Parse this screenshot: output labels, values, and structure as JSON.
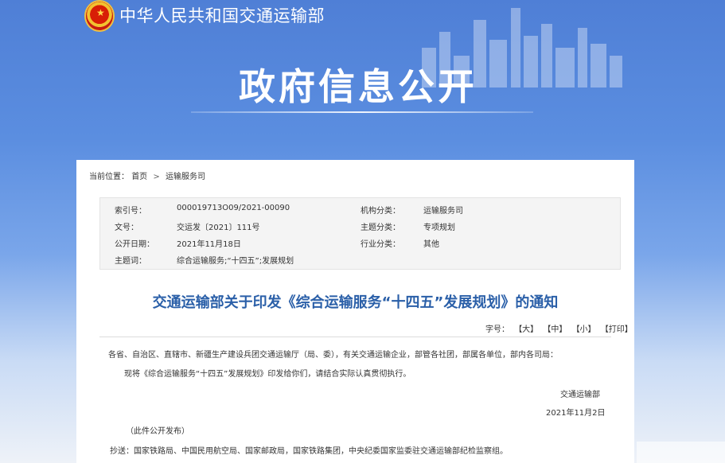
{
  "header": {
    "ministry_name": "中华人民共和国交通运输部",
    "banner_title": "政府信息公开"
  },
  "breadcrumb": {
    "prefix": "当前位置：",
    "items": [
      "首页",
      "运输服务司"
    ],
    "separator": ">"
  },
  "meta": {
    "index_label": "索引号：",
    "index_value": "000019713O09/2021-00090",
    "org_label": "机构分类：",
    "org_value": "运输服务司",
    "doc_no_label": "文号：",
    "doc_no_value": "交运发〔2021〕111号",
    "topic_label": "主题分类：",
    "topic_value": "专项规划",
    "date_label": "公开日期：",
    "date_value": "2021年11月18日",
    "industry_label": "行业分类：",
    "industry_value": "其他",
    "keywords_label": "主题词：",
    "keywords_value": "综合运输服务;“十四五”;发展规划"
  },
  "document": {
    "title": "交通运输部关于印发《综合运输服务“十四五”发展规划》的通知",
    "fontsize_label": "字号：",
    "fontsize_large": "【大】",
    "fontsize_medium": "【中】",
    "fontsize_small": "【小】",
    "print": "【打印】",
    "addressee": "各省、自治区、直辖市、新疆生产建设兵团交通运输厅（局、委），有关交通运输企业，部管各社团，部属各单位，部内各司局：",
    "body": "现将《综合运输服务“十四五”发展规划》印发给你们，请结合实际认真贯彻执行。",
    "signer": "交通运输部",
    "sign_date": "2021年11月2日",
    "public_note": "（此件公开发布）",
    "cc": "抄送：国家铁路局、中国民用航空局、国家邮政局，国家铁路集团，中央纪委国家监委驻交通运输部纪检监察组。"
  },
  "colors": {
    "banner_blue": "#5b8ee0",
    "title_blue": "#2a5fa8",
    "meta_bg": "#f4f4f4"
  }
}
